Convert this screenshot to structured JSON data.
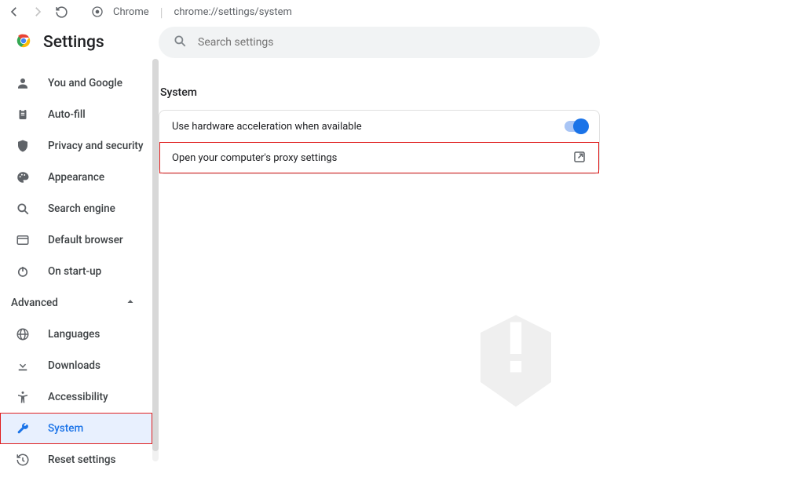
{
  "browser": {
    "app_label": "Chrome",
    "url": "chrome://settings/system"
  },
  "brand": {
    "title": "Settings"
  },
  "sidebar": {
    "items": [
      {
        "label": "You and Google"
      },
      {
        "label": "Auto-fill"
      },
      {
        "label": "Privacy and security"
      },
      {
        "label": "Appearance"
      },
      {
        "label": "Search engine"
      },
      {
        "label": "Default browser"
      },
      {
        "label": "On start-up"
      }
    ],
    "advanced_label": "Advanced",
    "advanced_items": [
      {
        "label": "Languages"
      },
      {
        "label": "Downloads"
      },
      {
        "label": "Accessibility"
      },
      {
        "label": "System"
      },
      {
        "label": "Reset settings"
      }
    ]
  },
  "search": {
    "placeholder": "Search settings"
  },
  "main": {
    "section_title": "System",
    "rows": [
      {
        "label": "Use hardware acceleration when available"
      },
      {
        "label": "Open your computer's proxy settings"
      }
    ]
  }
}
